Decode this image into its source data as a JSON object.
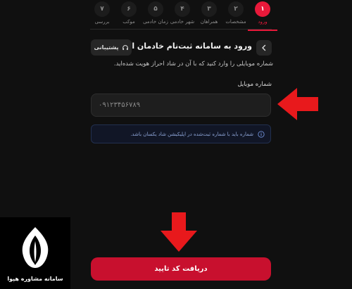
{
  "steps": [
    {
      "num": "۱",
      "label": "ورود",
      "active": true
    },
    {
      "num": "۲",
      "label": "مشخصات"
    },
    {
      "num": "۳",
      "label": "همراهان"
    },
    {
      "num": "۴",
      "label": "شهر خادمی"
    },
    {
      "num": "۵",
      "label": "زمان خادمی"
    },
    {
      "num": "۶",
      "label": "موکب"
    },
    {
      "num": "۷",
      "label": "بررسی"
    }
  ],
  "header": {
    "title": "ورود به سامانه ثبت‌نام خادمان ا...",
    "support_label": "پشتیبانی"
  },
  "subtitle": "شماره موبایلی را وارد کنید که با آن در شاد احراز هویت شده‌اید.",
  "form": {
    "phone_label": "شماره موبایل",
    "phone_placeholder": "۰۹۱۲۳۴۵۶۷۸۹"
  },
  "info": "شماره باید با شماره ثبت‌شده در اپلیکیشن شاد یکسان باشد.",
  "submit_label": "دریافت کد تایید",
  "logo_text": "سامانه مشاوره هپوا",
  "colors": {
    "accent": "#e8193a",
    "button": "#c8102e",
    "info_border": "#22304f"
  }
}
